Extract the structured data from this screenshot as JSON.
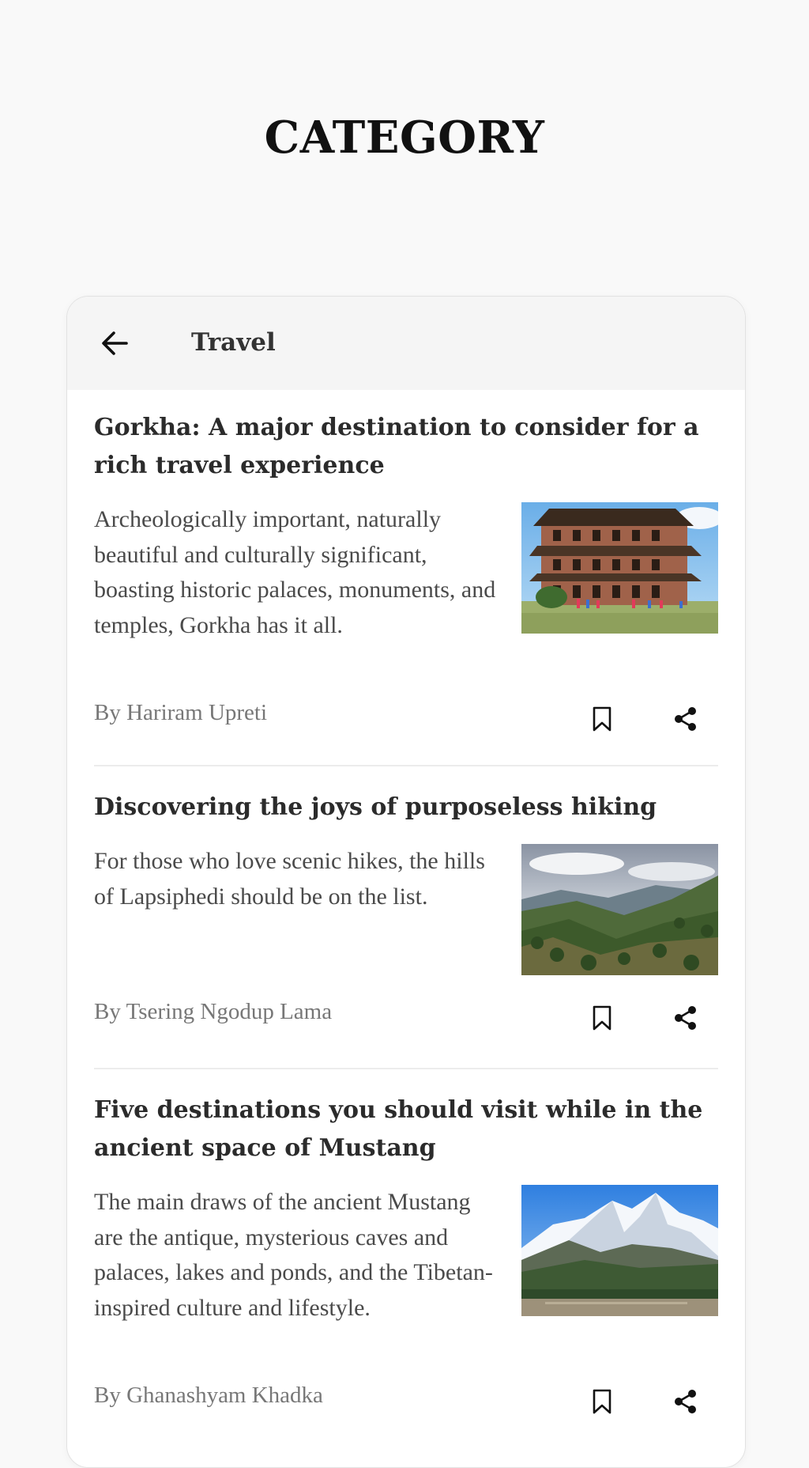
{
  "page": {
    "title": "CATEGORY"
  },
  "header": {
    "back_icon": "arrow-left-icon",
    "title": "Travel"
  },
  "articles": [
    {
      "title": "Gorkha: A major destination to consider for a rich travel experience",
      "summary": "Archeologically important, naturally beautiful and culturally significant, boasting historic palaces, monuments, and temples, Gorkha has it all.",
      "author": "By Hariram Upreti",
      "image": "brick-palace-photo"
    },
    {
      "title": "Discovering the joys of purposeless hiking",
      "summary": "For those who love scenic hikes, the hills of Lapsiphedi should be on the list.",
      "author": "By Tsering Ngodup Lama",
      "image": "green-hills-photo"
    },
    {
      "title": "Five destinations you should visit while in the ancient space of Mustang",
      "summary": "The main draws of the ancient Mustang are the antique, mysterious caves and palaces, lakes and ponds, and the Tibetan-inspired culture and lifestyle.",
      "author": "By Ghanashyam Khadka",
      "image": "snow-mountain-photo"
    }
  ],
  "icons": {
    "bookmark": "bookmark-icon",
    "share": "share-icon"
  },
  "colors": {
    "background": "#f9f9f9",
    "card": "#ffffff",
    "header": "#f5f5f5",
    "title_text": "#2b2b2b",
    "author_text": "#777777"
  }
}
